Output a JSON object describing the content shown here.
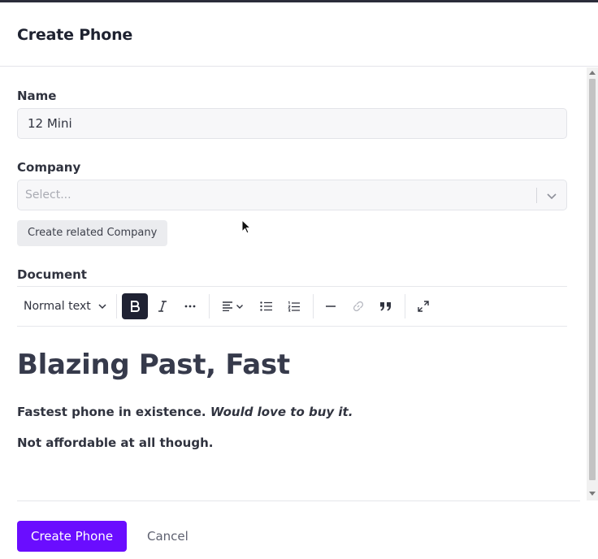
{
  "modal": {
    "title": "Create Phone"
  },
  "form": {
    "name": {
      "label": "Name",
      "value": "12 Mini"
    },
    "company": {
      "label": "Company",
      "placeholder": "Select...",
      "create_related_label": "Create related Company"
    },
    "document": {
      "label": "Document"
    }
  },
  "toolbar": {
    "text_style": "Normal text",
    "icons": [
      "bold-icon",
      "italic-icon",
      "more-icon",
      "align-icon",
      "bullet-list-icon",
      "ordered-list-icon",
      "horizontal-rule-icon",
      "link-icon",
      "blockquote-icon",
      "fullscreen-icon"
    ],
    "bold_active": true
  },
  "document": {
    "heading": "Blazing Past, Fast",
    "paragraph1_text": "Fastest phone in existence. ",
    "paragraph1_italic": "Would love to buy it.",
    "paragraph2": "Not affordable at all though."
  },
  "footer": {
    "primary_label": "Create Phone",
    "cancel_label": "Cancel"
  },
  "colors": {
    "primary": "#6a0dff",
    "toolbar_active": "#1f2233"
  }
}
